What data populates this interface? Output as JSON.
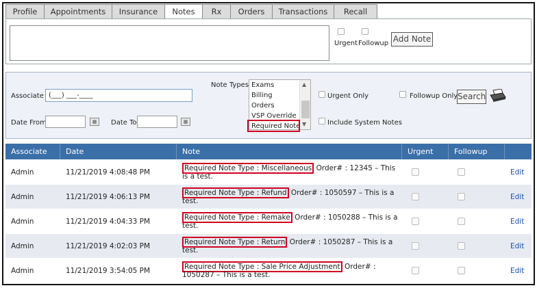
{
  "tabs": [
    "Profile",
    "Appointments",
    "Insurance",
    "Notes",
    "Rx",
    "Orders",
    "Transactions",
    "Recall"
  ],
  "active_tab": "Notes",
  "add_note": {
    "urgent_label": "Urgent",
    "followup_label": "Followup",
    "button_label": "Add Note"
  },
  "filter": {
    "associate_label": "Associate",
    "associate_value": "(___) ___-____",
    "date_from_label": "Date From",
    "date_to_label": "Date To",
    "note_types_label": "Note Types",
    "note_types": [
      "Exams",
      "Billing",
      "Orders",
      "VSP Override",
      "Required Note"
    ],
    "urgent_only_label": "Urgent Only",
    "followup_only_label": "Followup Only",
    "include_system_label": "Include System Notes",
    "search_label": "Search"
  },
  "grid": {
    "headers": [
      "Associate",
      "Date",
      "Note",
      "Urgent",
      "Followup",
      ""
    ],
    "rows": [
      {
        "associate": "Admin",
        "date": "11/21/2019 4:08:48 PM",
        "note_type": "Required Note Type : Miscellaneous",
        "note_rest": "Order# : 12345 – This is a test.",
        "edit": "Edit"
      },
      {
        "associate": "Admin",
        "date": "11/21/2019 4:06:13 PM",
        "note_type": "Required Note Type : Refund",
        "note_rest": "Order# : 1050597 – This is a test.",
        "edit": "Edit"
      },
      {
        "associate": "Admin",
        "date": "11/21/2019 4:04:33 PM",
        "note_type": "Required Note Type : Remake",
        "note_rest": "Order# : 1050288 – This is a test.",
        "edit": "Edit"
      },
      {
        "associate": "Admin",
        "date": "11/21/2019 4:02:03 PM",
        "note_type": "Required Note Type : Return",
        "note_rest": "Order# : 1050287 – This is a test.",
        "edit": "Edit"
      },
      {
        "associate": "Admin",
        "date": "11/21/2019 3:54:05 PM",
        "note_type": "Required Note Type : Sale Price Adjustment",
        "note_rest": "Order# : 1050287 – This is a test.",
        "edit": "Edit"
      }
    ]
  }
}
